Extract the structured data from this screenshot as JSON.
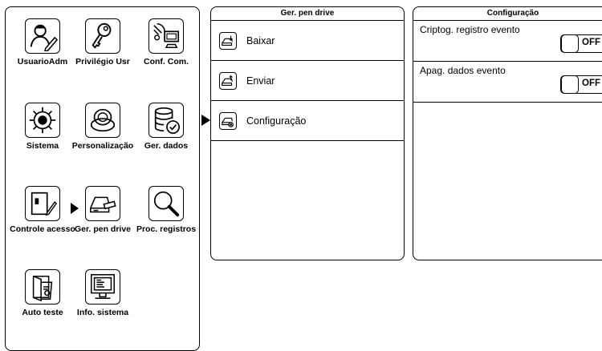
{
  "menu": {
    "items": [
      {
        "label": "UsuarioAdm",
        "icon": "user-edit-icon"
      },
      {
        "label": "Privilégio Usr",
        "icon": "key-icon"
      },
      {
        "label": "Conf. Com.",
        "icon": "network-computer-icon"
      },
      {
        "label": "Sistema",
        "icon": "gear-icon"
      },
      {
        "label": "Personalização",
        "icon": "personalize-icon"
      },
      {
        "label": "Ger. dados",
        "icon": "database-icon"
      },
      {
        "label": "Controle acesso",
        "icon": "door-access-icon"
      },
      {
        "label": "Ger. pen drive",
        "icon": "usb-drive-icon"
      },
      {
        "label": "Proc. registros",
        "icon": "magnifier-icon"
      },
      {
        "label": "Auto teste",
        "icon": "self-test-icon"
      },
      {
        "label": "Info. sistema",
        "icon": "system-info-icon"
      }
    ],
    "selected": "Ger. pen drive"
  },
  "pen_drive": {
    "title": "Ger. pen drive",
    "items": [
      {
        "label": "Baixar",
        "icon": "usb-download-icon"
      },
      {
        "label": "Enviar",
        "icon": "usb-upload-icon"
      },
      {
        "label": "Configuração",
        "icon": "usb-settings-icon"
      }
    ],
    "selected": "Configuração"
  },
  "config": {
    "title": "Configuração",
    "items": [
      {
        "label": "Criptog. registro evento",
        "state": "OFF"
      },
      {
        "label": "Apag. dados evento",
        "state": "OFF"
      }
    ]
  }
}
